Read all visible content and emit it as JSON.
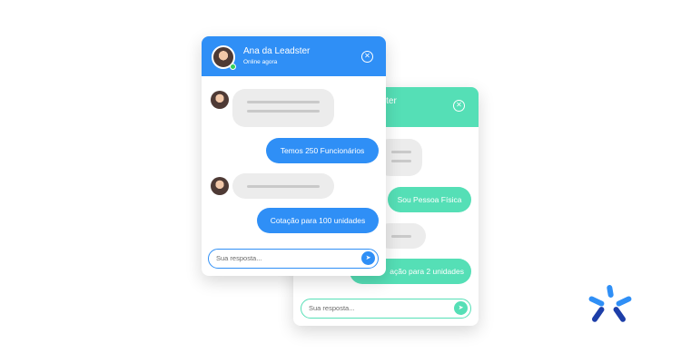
{
  "colors": {
    "front_accent": "#2f8ff6",
    "back_accent": "#55dfb6",
    "logo_blue": "#2f8ff6",
    "logo_dark": "#1d3ea8"
  },
  "front_widget": {
    "agent_name": "Ana da Leadster",
    "agent_status": "Online agora",
    "messages": {
      "user1": "Temos 250 Funcionários",
      "user2": "Cotação para 100 unidades"
    },
    "input_placeholder": "Sua resposta...",
    "icons": {
      "close": "close-icon",
      "send": "send-icon"
    }
  },
  "back_widget": {
    "agent_name_fragment": "adster",
    "messages": {
      "user1": "Sou Pessoa Física",
      "user2_fragment": "ação para 2 unidades"
    },
    "input_placeholder": "Sua resposta...",
    "icons": {
      "close": "close-icon",
      "send": "send-icon"
    }
  },
  "brand": {
    "logo": "leadster-logo"
  }
}
